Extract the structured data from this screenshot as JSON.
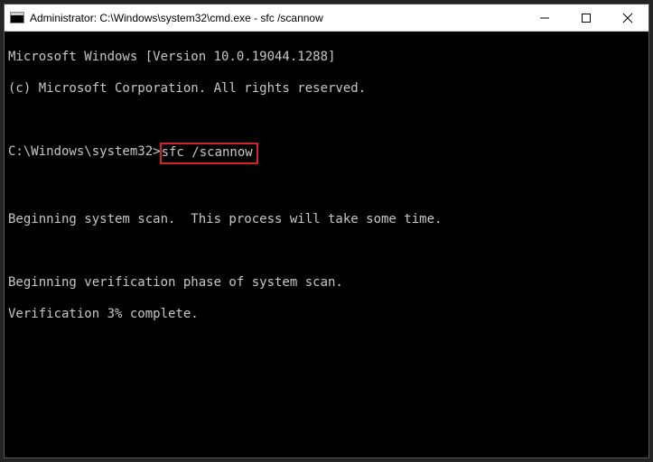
{
  "titlebar": {
    "title": "Administrator: C:\\Windows\\system32\\cmd.exe - sfc  /scannow"
  },
  "console": {
    "header1": "Microsoft Windows [Version 10.0.19044.1288]",
    "header2": "(c) Microsoft Corporation. All rights reserved.",
    "prompt": "C:\\Windows\\system32>",
    "command": "sfc /scannow",
    "msg_begin_scan": "Beginning system scan.  This process will take some time.",
    "msg_verify": "Beginning verification phase of system scan.",
    "msg_progress": "Verification 3% complete."
  },
  "highlight": {
    "color": "#d2232a"
  }
}
